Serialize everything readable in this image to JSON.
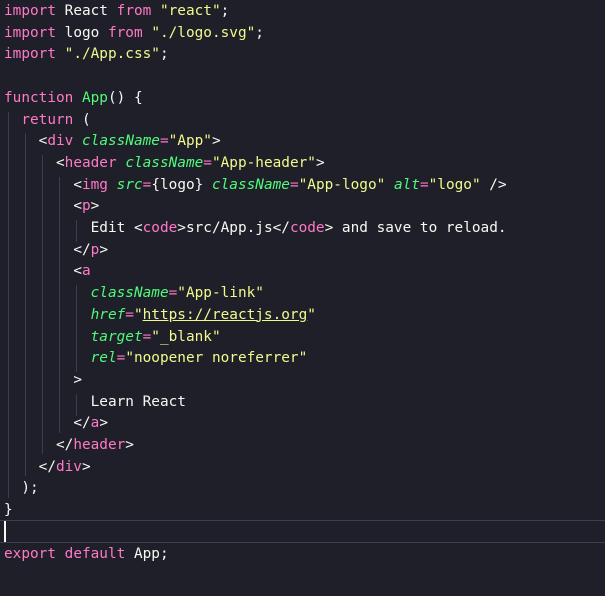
{
  "editor": {
    "line1": {
      "import": "import",
      "name": "React",
      "from": "from",
      "source": "\"react\""
    },
    "line2": {
      "import": "import",
      "name": "logo",
      "from": "from",
      "source": "\"./logo.svg\""
    },
    "line3": {
      "import": "import",
      "source": "\"./App.css\""
    },
    "line5": {
      "keyword": "function",
      "name": "App",
      "rest": "() {"
    },
    "line6": {
      "keyword": "return",
      "rest": " ("
    },
    "line7": {
      "open": "<",
      "tag": "div",
      "attr": "className",
      "eq": "=",
      "value": "\"App\"",
      "close": ">"
    },
    "line8": {
      "open": "<",
      "tag": "header",
      "attr": "className",
      "eq": "=",
      "value": "\"App-header\"",
      "close": ">"
    },
    "line9": {
      "open": "<",
      "tag": "img",
      "attr1": "src",
      "eq1": "=",
      "expr": "{logo}",
      "attr2": "className",
      "eq2": "=",
      "value2": "\"App-logo\"",
      "attr3": "alt",
      "eq3": "=",
      "value3": "\"logo\"",
      "close": " />"
    },
    "line10": {
      "open": "<",
      "tag": "p",
      "close": ">"
    },
    "line11": {
      "text1": "Edit ",
      "open1": "<",
      "tag1": "code",
      "close1": ">",
      "path": "src/App.js",
      "open2": "</",
      "tag2": "code",
      "close2": ">",
      "text2": " and save to reload."
    },
    "line12": {
      "open": "</",
      "tag": "p",
      "close": ">"
    },
    "line13": {
      "open": "<",
      "tag": "a"
    },
    "line14": {
      "attr": "className",
      "eq": "=",
      "value": "\"App-link\""
    },
    "line15": {
      "attr": "href",
      "eq": "=",
      "quote_open": "\"",
      "url": "https://reactjs.org",
      "quote_close": "\""
    },
    "line16": {
      "attr": "target",
      "eq": "=",
      "value": "\"_blank\""
    },
    "line17": {
      "attr": "rel",
      "eq": "=",
      "value": "\"noopener noreferrer\""
    },
    "line18": {
      "close": ">"
    },
    "line19": {
      "text": "Learn React"
    },
    "line20": {
      "open": "</",
      "tag": "a",
      "close": ">"
    },
    "line21": {
      "open": "</",
      "tag": "header",
      "close": ">"
    },
    "line22": {
      "open": "</",
      "tag": "div",
      "close": ">"
    },
    "line23": {
      "text": ");"
    },
    "line24": {
      "text": "}"
    },
    "line26": {
      "keyword1": "export",
      "keyword2": "default",
      "name": "App",
      "semi": ";"
    }
  }
}
